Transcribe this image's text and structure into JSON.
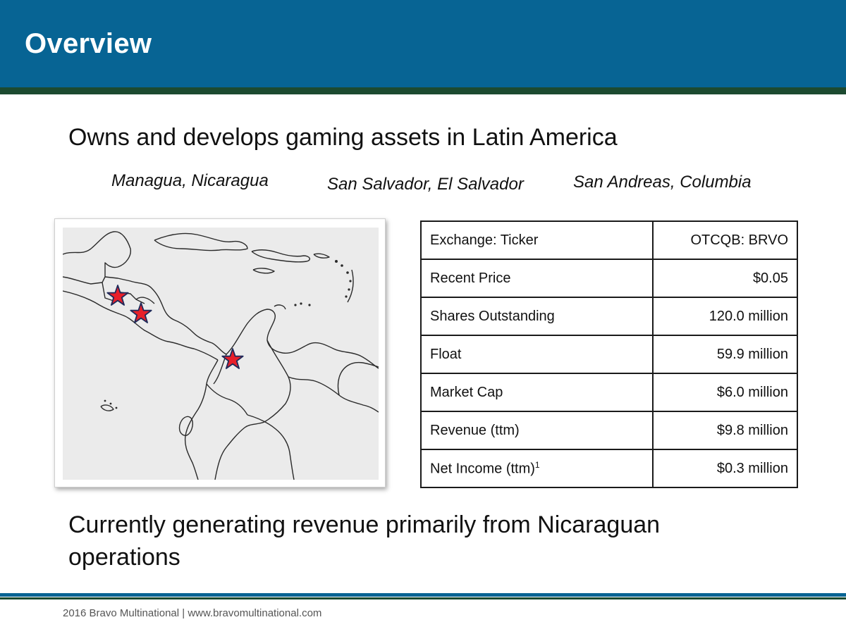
{
  "slide": {
    "title": "Overview",
    "headline": "Owns and develops gaming assets in Latin America",
    "locations": [
      "Managua, Nicaragua",
      "San Salvador, El Salvador",
      "San Andreas, Columbia"
    ],
    "bottom_text": "Currently generating revenue primarily from Nicaraguan operations",
    "footer": "2016 Bravo Multinational | www.bravomultinational.com"
  },
  "colors": {
    "header_blue": "#076494",
    "header_rule_green": "#1c4a30",
    "star_red": "#e8202a",
    "star_outline": "#1f2a5a"
  },
  "map": {
    "markers": [
      "star-icon",
      "star-icon",
      "star-icon"
    ]
  },
  "stats_table": {
    "rows": [
      {
        "label": "Exchange: Ticker",
        "value": "OTCQB: BRVO"
      },
      {
        "label": "Recent Price",
        "value": "$0.05"
      },
      {
        "label": "Shares Outstanding",
        "value": "120.0 million"
      },
      {
        "label": "Float",
        "value": "59.9 million"
      },
      {
        "label": "Market Cap",
        "value": "$6.0 million"
      },
      {
        "label": "Revenue (ttm)",
        "value": "$9.8 million"
      },
      {
        "label": "Net Income (ttm)",
        "label_sup": "1",
        "value": "$0.3 million"
      }
    ]
  }
}
